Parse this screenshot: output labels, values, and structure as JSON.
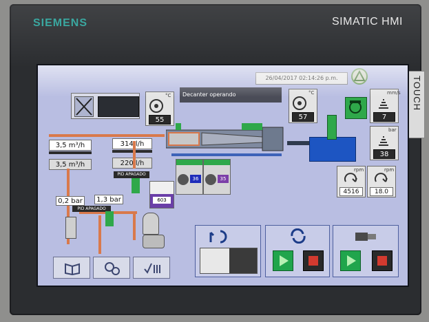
{
  "bezel": {
    "brand": "SIEMENS",
    "model": "SIMATIC HMI",
    "touch_label": "TOUCH"
  },
  "header": {
    "datetime": "26/04/2017 02:14:26 p.m.",
    "status_message": "Decanter operando"
  },
  "flows": {
    "flow_1_value": "3,5 m³/h",
    "flow_1_setpoint": "3,5 m³/h",
    "flow_2_value": "314 l/h",
    "flow_2_setpoint": "220 l/h",
    "pid_label_1": "PID APAGADO"
  },
  "pressures": {
    "pressure_1": "0,2 bar",
    "pressure_2": "1,3 bar",
    "pid_label_2": "PID APAGADO"
  },
  "bearings": {
    "bearing_1_unit": "°C",
    "bearing_1_value": "55",
    "bearing_2_unit": "°C",
    "bearing_2_value": "57"
  },
  "vibration": {
    "top_unit": "mm/s",
    "top_value": "7",
    "bottom_unit": "bar",
    "bottom_value": "38"
  },
  "tanks": {
    "tank_a_value": "36",
    "tank_b_value": "35",
    "tank_c_value": "603"
  },
  "speeds": {
    "bowl_unit": "rpm",
    "bowl_value": "4516",
    "diff_unit": "rpm",
    "diff_value": "18.0"
  },
  "colors": {
    "screen_bg": "#b9bee2",
    "pipe_orange": "#d9794b",
    "pipe_blue": "#3d62b8",
    "accent_green": "#2fa84a",
    "stop_red": "#d33a2f"
  },
  "icons": {
    "nav_1": "book-icon",
    "nav_2": "gears-icon",
    "nav_3": "checklist-icon",
    "panel_1": "hand-rotate-icon",
    "panel_2": "rotate-arrows-icon",
    "panel_3": "pump-motor-icon"
  }
}
